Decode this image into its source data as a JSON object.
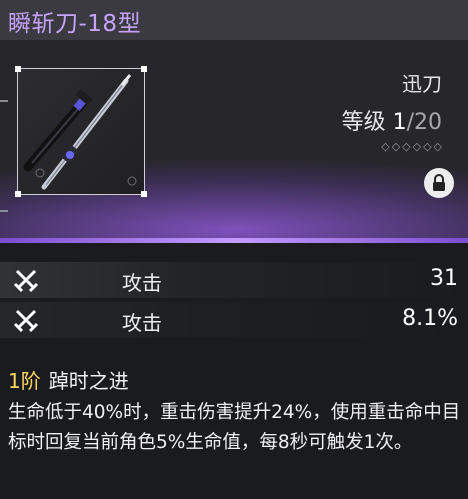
{
  "weapon": {
    "name": "瞬斩刀-18型",
    "type": "迅刀",
    "level_label": "等级",
    "level_current": "1",
    "level_sep": "/",
    "level_max": "20",
    "rank_diamonds": "◇◇◇◇◇◇",
    "locked": true
  },
  "stats": [
    {
      "name": "攻击",
      "value": "31"
    },
    {
      "name": "攻击",
      "value": "8.1%"
    }
  ],
  "effect": {
    "rank": "1阶",
    "name": "踔时之进",
    "description": "生命低于40%时，重击伤害提升24%，使用重击命中目标时回复当前角色5%生命值，每8秒可触发1次。"
  },
  "colors": {
    "title": "#c7a3ff",
    "accent_glow": "#9b5feb",
    "rank_gold": "#ffd75e"
  },
  "icons": [
    "sword-image",
    "lock-icon",
    "crossed-swords-icon"
  ]
}
